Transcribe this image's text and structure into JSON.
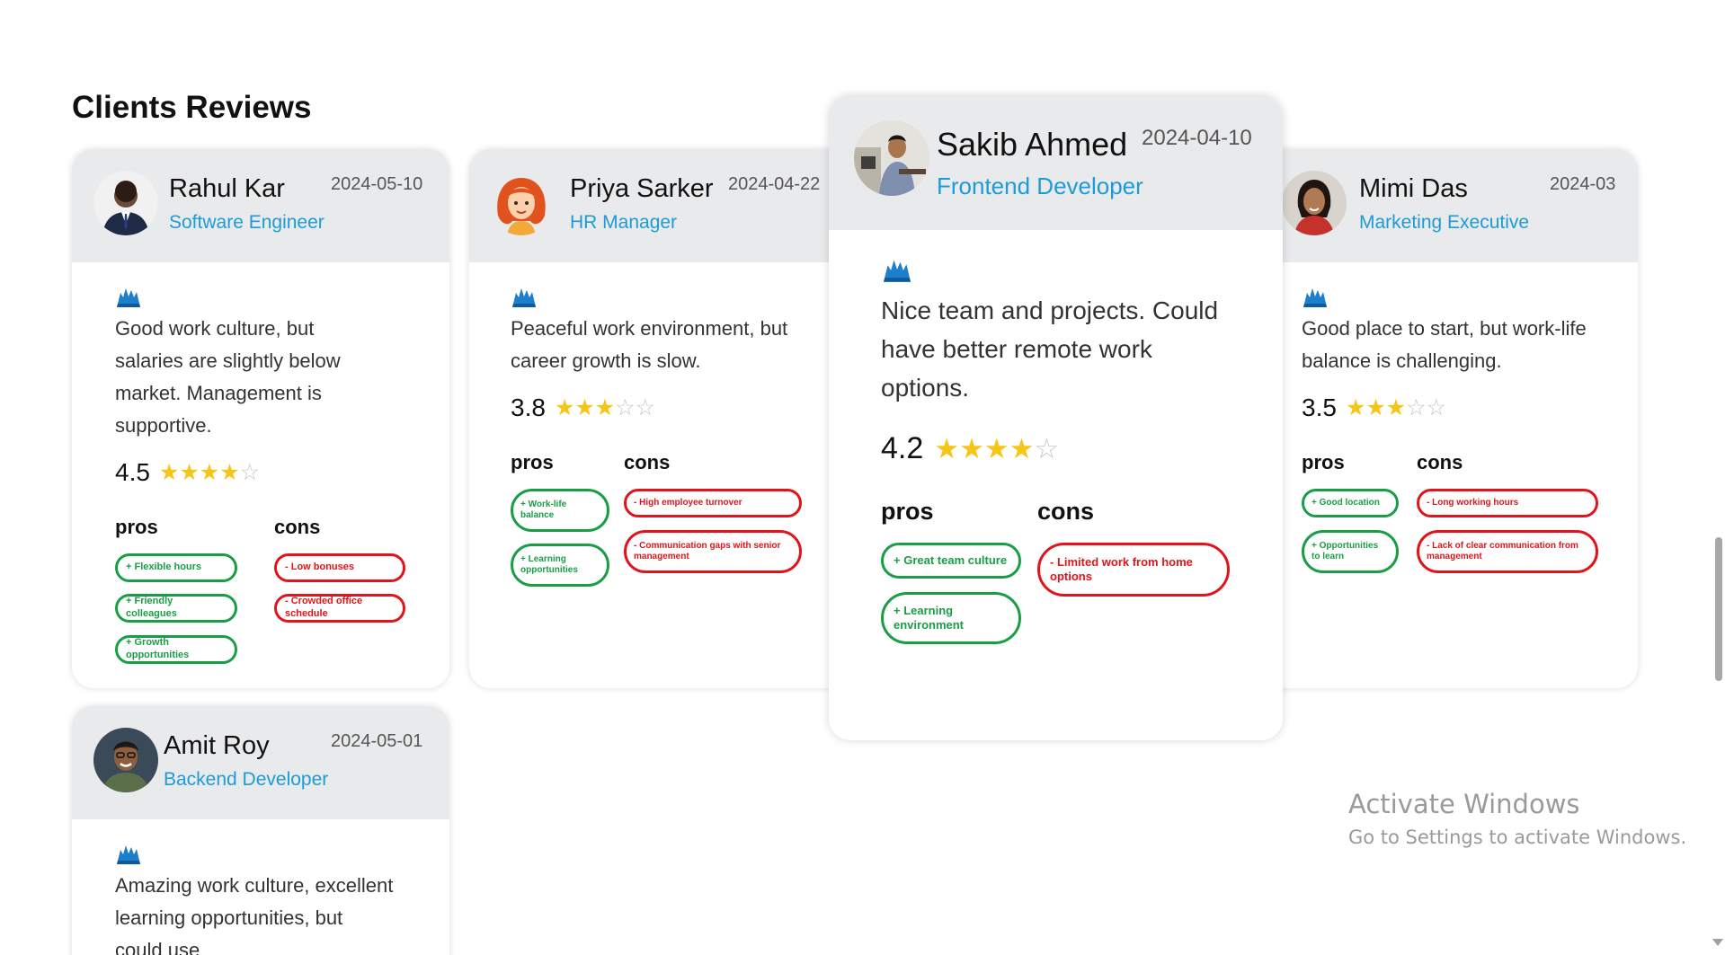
{
  "section": {
    "title": "Clients Reviews"
  },
  "reviews": [
    {
      "name": "Rahul Kar",
      "role": "Software Engineer",
      "date": "2024-05-10",
      "text": "Good work culture, but salaries are slightly below market. Management is supportive.",
      "rating": "4.5",
      "stars_filled": 4,
      "stars_total": 5,
      "pros_label": "pros",
      "cons_label": "cons",
      "pros": [
        "+ Flexible hours",
        "+ Friendly colleagues",
        "+ Growth opportunities"
      ],
      "cons": [
        "- Low bonuses",
        "- Crowded office schedule"
      ]
    },
    {
      "name": "Priya Sarker",
      "role": "HR Manager",
      "date": "2024-04-22",
      "text": "Peaceful work environment, but career growth is slow.",
      "rating": "3.8",
      "stars_filled": 3,
      "stars_total": 5,
      "pros_label": "pros",
      "cons_label": "cons",
      "pros": [
        "+ Work-life balance",
        "+ Learning opportunities"
      ],
      "cons": [
        "- High employee turnover",
        "- Communication gaps with senior management"
      ]
    },
    {
      "name": "Sakib Ahmed",
      "role": "Frontend Developer",
      "date": "2024-04-10",
      "text": "Nice team and projects. Could have better remote work options.",
      "rating": "4.2",
      "stars_filled": 4,
      "stars_total": 5,
      "pros_label": "pros",
      "cons_label": "cons",
      "pros": [
        "+ Great team culture",
        "+ Learning environment"
      ],
      "cons": [
        "- Limited work from home options"
      ]
    },
    {
      "name": "Mimi Das",
      "role": "Marketing Executive",
      "date": "2024-03",
      "text": "Good place to start, but work-life balance is challenging.",
      "rating": "3.5",
      "stars_filled": 3,
      "stars_total": 5,
      "pros_label": "pros",
      "cons_label": "cons",
      "pros": [
        "+ Good location",
        "+ Opportunities to learn"
      ],
      "cons": [
        "- Long working hours",
        "- Lack of clear communication from management"
      ]
    },
    {
      "name": "Amit Roy",
      "role": "Backend Developer",
      "date": "2024-05-01",
      "text": "Amazing work culture, excellent learning opportunities, but could use"
    }
  ],
  "watermark": {
    "title": "Activate Windows",
    "subtitle": "Go to Settings to activate Windows."
  },
  "colors": {
    "accent": "#1d9bd7",
    "star": "#f5c518",
    "pro": "#1a9e45",
    "con": "#e0151c",
    "header_bg": "#e9eaec"
  },
  "icons": {
    "quote": "quote-icon",
    "star_full": "star-filled-icon",
    "star_empty": "star-empty-icon"
  }
}
